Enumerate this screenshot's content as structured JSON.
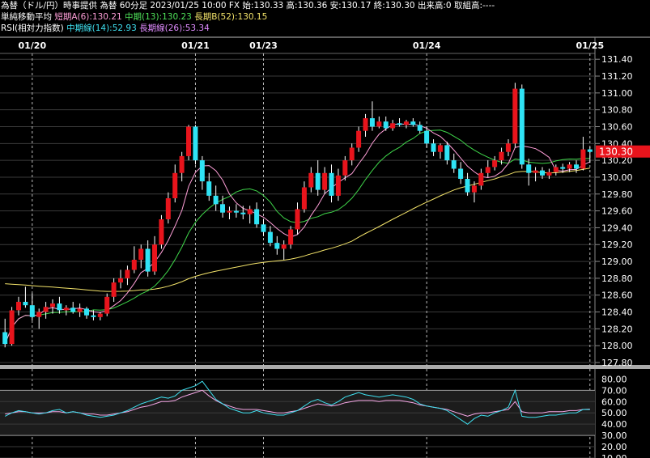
{
  "header": {
    "line1": "為替（ドル/円）時事提供 為替 60分足 2023/01/25 10:00 FX 始:130.33 高:130.36 安:130.17 終:130.30 出来高:0 取組高:----",
    "line2_label": "単純移動平均",
    "ma_short": "短期A(6):130.21",
    "ma_mid": "中期(13):130.23",
    "ma_long": "長期B(52):130.15",
    "line3_label": "RSI(相対力指数)",
    "rsi_mid": "中期線(14):52.93",
    "rsi_long": "長期線(26):53.34"
  },
  "colors": {
    "up": "#e8141c",
    "down": "#2fe3f5",
    "ma_short": "#ff9fd8",
    "ma_mid": "#3fd64a",
    "ma_long": "#f3e36a",
    "rsi_mid": "#3fe0f0",
    "rsi_long": "#f5a6e6",
    "current_badge": "#e8141c"
  },
  "chart_data": [
    {
      "type": "candlestick",
      "date_labels": [
        {
          "label": "01/20",
          "bar": 4
        },
        {
          "label": "01/21",
          "bar": 28
        },
        {
          "label": "01/23",
          "bar": 38
        },
        {
          "label": "01/24",
          "bar": 62
        },
        {
          "label": "01/25",
          "bar": 86
        }
      ],
      "ylim": [
        127.8,
        131.45
      ],
      "yticks": [
        "131.40",
        "131.20",
        "131.00",
        "130.80",
        "130.60",
        "130.40",
        "130.20",
        "130.00",
        "129.80",
        "129.60",
        "129.40",
        "129.20",
        "129.00",
        "128.80",
        "128.60",
        "128.40",
        "128.20",
        "128.00",
        "127.80"
      ],
      "current_price": "130.30",
      "ohlc": [
        [
          128.16,
          128.32,
          127.98,
          128.02
        ],
        [
          128.02,
          128.46,
          128.0,
          128.42
        ],
        [
          128.42,
          128.58,
          128.36,
          128.52
        ],
        [
          128.52,
          128.7,
          128.45,
          128.48
        ],
        [
          128.48,
          128.62,
          128.3,
          128.34
        ],
        [
          128.34,
          128.44,
          128.2,
          128.4
        ],
        [
          128.4,
          128.52,
          128.32,
          128.46
        ],
        [
          128.46,
          128.55,
          128.38,
          128.5
        ],
        [
          128.5,
          128.58,
          128.38,
          128.42
        ],
        [
          128.42,
          128.48,
          128.36,
          128.45
        ],
        [
          128.45,
          128.52,
          128.38,
          128.4
        ],
        [
          128.4,
          128.5,
          128.34,
          128.44
        ],
        [
          128.44,
          128.46,
          128.32,
          128.36
        ],
        [
          128.36,
          128.42,
          128.3,
          128.34
        ],
        [
          128.34,
          128.4,
          128.3,
          128.38
        ],
        [
          128.38,
          128.62,
          128.35,
          128.58
        ],
        [
          128.58,
          128.8,
          128.52,
          128.75
        ],
        [
          128.75,
          128.9,
          128.68,
          128.8
        ],
        [
          128.8,
          128.95,
          128.72,
          128.9
        ],
        [
          128.9,
          129.18,
          128.86,
          129.02
        ],
        [
          129.02,
          129.2,
          128.92,
          129.15
        ],
        [
          129.15,
          129.25,
          128.82,
          128.88
        ],
        [
          128.88,
          129.3,
          128.84,
          129.2
        ],
        [
          129.2,
          129.55,
          129.15,
          129.5
        ],
        [
          129.5,
          129.82,
          129.45,
          129.75
        ],
        [
          129.75,
          130.15,
          129.7,
          130.05
        ],
        [
          130.05,
          130.3,
          129.95,
          130.25
        ],
        [
          130.25,
          130.62,
          130.2,
          130.6
        ],
        [
          130.6,
          130.62,
          130.15,
          130.2
        ],
        [
          130.2,
          130.25,
          129.85,
          129.95
        ],
        [
          129.95,
          130.05,
          129.72,
          129.78
        ],
        [
          129.78,
          129.9,
          129.6,
          129.68
        ],
        [
          129.68,
          129.78,
          129.52,
          129.58
        ],
        [
          129.58,
          129.65,
          129.5,
          129.6
        ],
        [
          129.6,
          129.68,
          129.52,
          129.58
        ],
        [
          129.58,
          129.66,
          129.5,
          129.56
        ],
        [
          129.56,
          129.66,
          129.45,
          129.62
        ],
        [
          129.62,
          129.7,
          129.4,
          129.44
        ],
        [
          129.44,
          129.5,
          129.3,
          129.35
        ],
        [
          129.35,
          129.42,
          129.18,
          129.22
        ],
        [
          129.22,
          129.3,
          129.08,
          129.15
        ],
        [
          129.15,
          129.25,
          129.02,
          129.2
        ],
        [
          129.2,
          129.42,
          129.15,
          129.38
        ],
        [
          129.38,
          129.7,
          129.32,
          129.62
        ],
        [
          129.62,
          129.95,
          129.58,
          129.88
        ],
        [
          129.88,
          130.12,
          129.82,
          130.05
        ],
        [
          130.05,
          130.2,
          129.78,
          129.85
        ],
        [
          129.85,
          130.12,
          129.8,
          130.05
        ],
        [
          130.05,
          130.15,
          129.7,
          129.78
        ],
        [
          129.78,
          130.1,
          129.72,
          130.02
        ],
        [
          130.02,
          130.25,
          129.96,
          130.2
        ],
        [
          130.2,
          130.4,
          130.14,
          130.35
        ],
        [
          130.35,
          130.6,
          130.3,
          130.55
        ],
        [
          130.55,
          130.75,
          130.48,
          130.7
        ],
        [
          130.7,
          130.9,
          130.55,
          130.6
        ],
        [
          130.6,
          130.72,
          130.58,
          130.66
        ],
        [
          130.66,
          130.72,
          130.55,
          130.58
        ],
        [
          130.58,
          130.68,
          130.55,
          130.64
        ],
        [
          130.64,
          130.7,
          130.6,
          130.62
        ],
        [
          130.62,
          130.68,
          130.58,
          130.66
        ],
        [
          130.66,
          130.7,
          130.6,
          130.62
        ],
        [
          130.62,
          130.66,
          130.52,
          130.55
        ],
        [
          130.55,
          130.6,
          130.35,
          130.4
        ],
        [
          130.4,
          130.45,
          130.25,
          130.3
        ],
        [
          130.3,
          130.4,
          130.22,
          130.38
        ],
        [
          130.38,
          130.42,
          130.15,
          130.2
        ],
        [
          130.2,
          130.28,
          130.05,
          130.1
        ],
        [
          130.1,
          130.18,
          129.92,
          129.98
        ],
        [
          129.98,
          130.05,
          129.78,
          129.82
        ],
        [
          129.82,
          129.95,
          129.7,
          129.9
        ],
        [
          129.9,
          130.1,
          129.85,
          130.05
        ],
        [
          130.05,
          130.2,
          130.0,
          130.12
        ],
        [
          130.12,
          130.25,
          130.08,
          130.2
        ],
        [
          130.2,
          130.35,
          130.15,
          130.3
        ],
        [
          130.3,
          130.45,
          130.25,
          130.4
        ],
        [
          130.4,
          131.12,
          130.35,
          131.05
        ],
        [
          131.05,
          131.1,
          130.1,
          130.15
        ],
        [
          130.15,
          130.22,
          129.9,
          130.05
        ],
        [
          130.05,
          130.12,
          129.95,
          130.08
        ],
        [
          130.08,
          130.12,
          129.98,
          130.02
        ],
        [
          130.02,
          130.1,
          129.98,
          130.06
        ],
        [
          130.06,
          130.15,
          130.02,
          130.12
        ],
        [
          130.12,
          130.16,
          130.05,
          130.1
        ],
        [
          130.1,
          130.18,
          130.06,
          130.15
        ],
        [
          130.15,
          130.2,
          130.05,
          130.1
        ],
        [
          130.1,
          130.48,
          130.08,
          130.33
        ],
        [
          130.33,
          130.36,
          130.17,
          130.3
        ]
      ]
    },
    {
      "type": "line",
      "title": "RSI",
      "ylim": [
        10,
        86
      ],
      "yticks": [
        "80.00",
        "70.00",
        "60.00",
        "50.00",
        "40.00",
        "30.00",
        "20.00",
        "10.00"
      ],
      "series": [
        {
          "name": "中期線(14)",
          "color": "#3fe0f0",
          "values": [
            47,
            50,
            52,
            51,
            50,
            49,
            50,
            52,
            53,
            50,
            51,
            50,
            48,
            47,
            46,
            47,
            48,
            50,
            52,
            55,
            58,
            60,
            62,
            64,
            63,
            65,
            70,
            72,
            74,
            78,
            70,
            62,
            58,
            54,
            52,
            50,
            50,
            52,
            50,
            49,
            48,
            48,
            50,
            52,
            56,
            60,
            62,
            59,
            57,
            60,
            64,
            66,
            68,
            66,
            65,
            64,
            65,
            66,
            65,
            64,
            62,
            58,
            56,
            55,
            54,
            52,
            48,
            44,
            40,
            45,
            48,
            47,
            50,
            52,
            55,
            70,
            47,
            46,
            46,
            47,
            48,
            48,
            49,
            50,
            50,
            53,
            52.93
          ]
        },
        {
          "name": "長期線(26)",
          "color": "#f5a6e6",
          "values": [
            49,
            50,
            51,
            51,
            50,
            50,
            50,
            51,
            51,
            50,
            51,
            50,
            49,
            49,
            48,
            48,
            49,
            50,
            51,
            53,
            55,
            56,
            58,
            60,
            60,
            61,
            64,
            66,
            68,
            70,
            65,
            61,
            58,
            56,
            54,
            53,
            53,
            53,
            52,
            51,
            50,
            50,
            51,
            52,
            54,
            56,
            58,
            57,
            56,
            57,
            59,
            60,
            61,
            61,
            61,
            60,
            61,
            61,
            61,
            60,
            59,
            57,
            56,
            55,
            54,
            53,
            51,
            49,
            47,
            49,
            50,
            50,
            51,
            52,
            53,
            60,
            51,
            50,
            50,
            50,
            51,
            51,
            51,
            52,
            52,
            53,
            53.34
          ]
        }
      ]
    }
  ]
}
